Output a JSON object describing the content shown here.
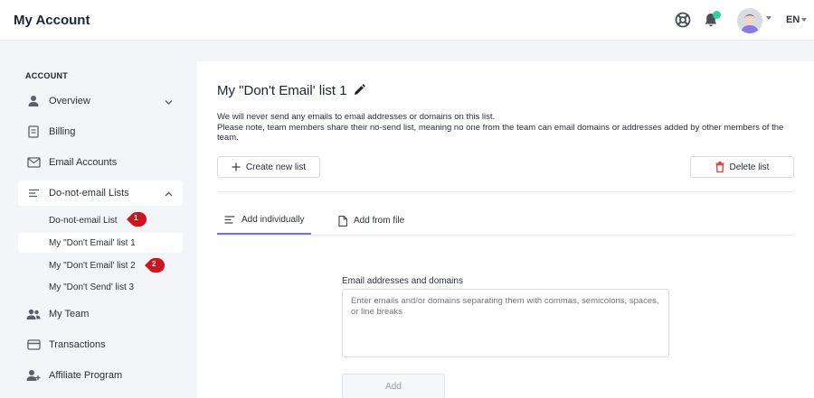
{
  "header": {
    "title": "My Account",
    "icons": {
      "support": "lifebuoy-icon",
      "notifications": "bell-icon",
      "avatar": "user-avatar"
    },
    "notification_dot_color": "#2ed3a0",
    "language": "EN"
  },
  "sidebar": {
    "heading": "ACCOUNT",
    "items": [
      {
        "label": "Overview",
        "icon": "person-icon",
        "expandable": true,
        "expanded": false
      },
      {
        "label": "Billing",
        "icon": "receipt-icon"
      },
      {
        "label": "Email Accounts",
        "icon": "envelope-icon"
      },
      {
        "label": "Do-not-email Lists",
        "icon": "list-icon",
        "expandable": true,
        "expanded": true
      },
      {
        "label": "My Team",
        "icon": "team-icon"
      },
      {
        "label": "Transactions",
        "icon": "card-icon"
      },
      {
        "label": "Affiliate Program",
        "icon": "person-add-icon"
      }
    ],
    "sub_items": [
      {
        "label": "Do-not-email List",
        "marker": "1"
      },
      {
        "label": "My \"Don't Email' list 1",
        "active": true
      },
      {
        "label": "My \"Don't Email' list 2",
        "marker": "2"
      },
      {
        "label": "My \"Don't Send' list 3"
      }
    ],
    "marker_color": "#d0141d"
  },
  "main": {
    "title": "My \"Don't Email' list 1",
    "description": [
      "We will never send any emails to email addresses or domains on this list.",
      "Please note, team members share their no-send list, meaning no one from the team can email domains or addresses added by other members of the team."
    ],
    "create_button": "Create new list",
    "delete_button": "Delete list",
    "delete_icon_color": "#e53935",
    "tabs": [
      {
        "label": "Add individually",
        "active": true
      },
      {
        "label": "Add from file",
        "active": false
      }
    ],
    "active_tab_color": "#7b6fe0",
    "field_label": "Email addresses and domains",
    "field_placeholder": "Enter emails and/or domains separating them with commas, semicolons, spaces, or line breaks",
    "field_value": "",
    "add_button": "Add"
  }
}
